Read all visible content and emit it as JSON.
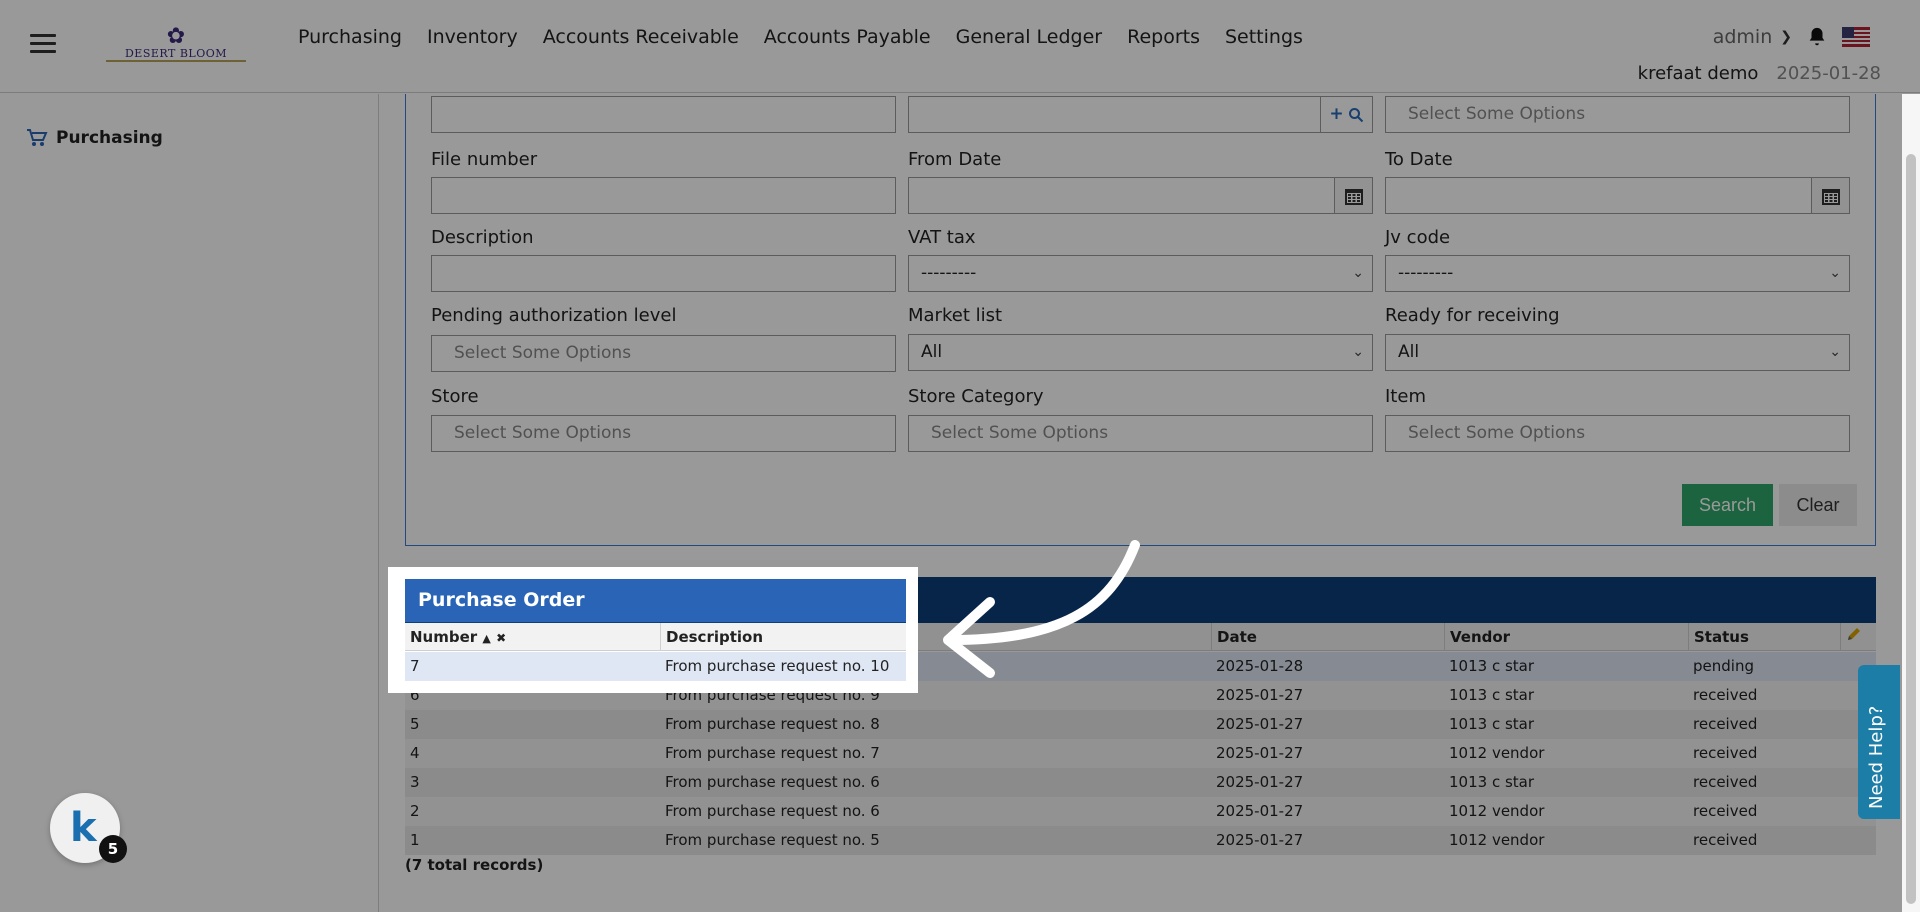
{
  "topbar": {
    "logo_text": "DESERT BLOOM",
    "nav": [
      "Purchasing",
      "Inventory",
      "Accounts Receivable",
      "Accounts Payable",
      "General Ledger",
      "Reports",
      "Settings"
    ],
    "user": "admin",
    "company": "krefaat demo",
    "date": "2025-01-28"
  },
  "sidebar": {
    "items": [
      {
        "label": "Purchasing",
        "icon": "cart-icon"
      }
    ]
  },
  "form": {
    "row0": {
      "placeholder_right": "Select Some Options"
    },
    "file_number": {
      "label": "File number"
    },
    "from_date": {
      "label": "From Date"
    },
    "to_date": {
      "label": "To Date"
    },
    "description": {
      "label": "Description"
    },
    "vat_tax": {
      "label": "VAT tax",
      "value": "---------"
    },
    "jv_code": {
      "label": "Jv code",
      "value": "---------"
    },
    "pending_auth": {
      "label": "Pending authorization level",
      "placeholder": "Select Some Options"
    },
    "market_list": {
      "label": "Market list",
      "value": "All"
    },
    "ready_receiving": {
      "label": "Ready for receiving",
      "value": "All"
    },
    "store": {
      "label": "Store",
      "placeholder": "Select Some Options"
    },
    "store_category": {
      "label": "Store Category",
      "placeholder": "Select Some Options"
    },
    "item": {
      "label": "Item",
      "placeholder": "Select Some Options"
    },
    "search_label": "Search",
    "clear_label": "Clear"
  },
  "grid": {
    "title": "Purchase Order",
    "columns": {
      "number": "Number",
      "description": "Description",
      "date": "Date",
      "vendor": "Vendor",
      "status": "Status"
    },
    "rows": [
      {
        "number": "7",
        "description": "From purchase request no. 10",
        "date": "2025-01-28",
        "vendor": "1013 c star",
        "status": "pending"
      },
      {
        "number": "6",
        "description": "From purchase request no. 9",
        "date": "2025-01-27",
        "vendor": "1013 c star",
        "status": "received"
      },
      {
        "number": "5",
        "description": "From purchase request no. 8",
        "date": "2025-01-27",
        "vendor": "1013 c star",
        "status": "received"
      },
      {
        "number": "4",
        "description": "From purchase request no. 7",
        "date": "2025-01-27",
        "vendor": "1012 vendor",
        "status": "received"
      },
      {
        "number": "3",
        "description": "From purchase request no. 6",
        "date": "2025-01-27",
        "vendor": "1013 c star",
        "status": "received"
      },
      {
        "number": "2",
        "description": "From purchase request no. 6",
        "date": "2025-01-27",
        "vendor": "1012 vendor",
        "status": "received"
      },
      {
        "number": "1",
        "description": "From purchase request no. 5",
        "date": "2025-01-27",
        "vendor": "1012 vendor",
        "status": "received"
      }
    ],
    "total": "(7 total records)"
  },
  "help": {
    "label": "Need Help?"
  },
  "badge": {
    "letter": "k",
    "count": "5"
  },
  "colors": {
    "accent": "#2a64b6",
    "grid_header": "#0d3f7a",
    "search": "#2fa66a",
    "help": "#1c7ea6"
  }
}
